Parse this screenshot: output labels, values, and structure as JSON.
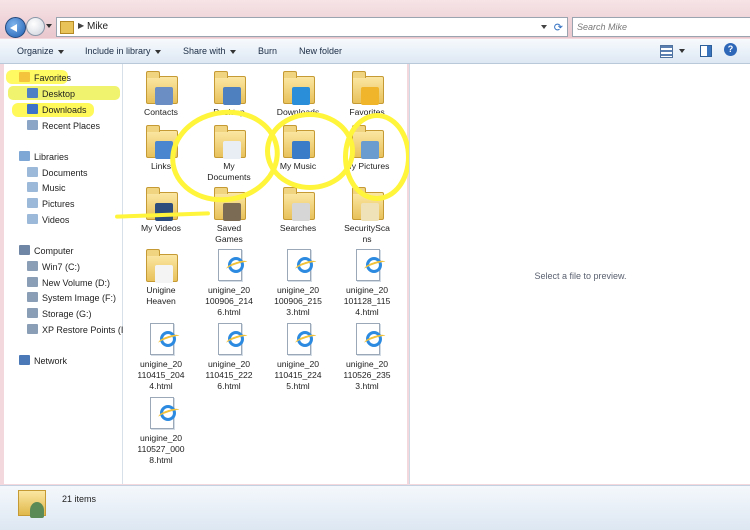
{
  "address": {
    "crumb": "Mike"
  },
  "search": {
    "placeholder": "Search Mike"
  },
  "toolbar": {
    "organize": "Organize",
    "include": "Include in library",
    "share": "Share with",
    "burn": "Burn",
    "new_folder": "New folder"
  },
  "nav": {
    "favorites": "Favorites",
    "favorites_items": [
      "Desktop",
      "Downloads",
      "Recent Places"
    ],
    "libraries": "Libraries",
    "libraries_items": [
      "Documents",
      "Music",
      "Pictures",
      "Videos"
    ],
    "computer": "Computer",
    "computer_items": [
      "Win7 (C:)",
      "New Volume (D:)",
      "System Image (F:)",
      "Storage (G:)",
      "XP Restore Points (I:"
    ],
    "network": "Network"
  },
  "files": [
    {
      "l1": "Contacts",
      "l2": ""
    },
    {
      "l1": "Desktop",
      "l2": ""
    },
    {
      "l1": "Downloads",
      "l2": ""
    },
    {
      "l1": "Favorites",
      "l2": ""
    },
    {
      "l1": "Links",
      "l2": ""
    },
    {
      "l1": "My",
      "l2": "Documents"
    },
    {
      "l1": "My Music",
      "l2": ""
    },
    {
      "l1": "My Pictures",
      "l2": ""
    },
    {
      "l1": "My Videos",
      "l2": ""
    },
    {
      "l1": "Saved",
      "l2": "Games"
    },
    {
      "l1": "Searches",
      "l2": ""
    },
    {
      "l1": "SecuritySca",
      "l2": "ns"
    },
    {
      "l1": "Unigine",
      "l2": "Heaven"
    },
    {
      "l1": "unigine_20",
      "l2": "100906_214",
      "l3": "6.html"
    },
    {
      "l1": "unigine_20",
      "l2": "100906_215",
      "l3": "3.html"
    },
    {
      "l1": "unigine_20",
      "l2": "101128_115",
      "l3": "4.html"
    },
    {
      "l1": "unigine_20",
      "l2": "110415_204",
      "l3": "4.html"
    },
    {
      "l1": "unigine_20",
      "l2": "110415_222",
      "l3": "6.html"
    },
    {
      "l1": "unigine_20",
      "l2": "110415_224",
      "l3": "5.html"
    },
    {
      "l1": "unigine_20",
      "l2": "110526_235",
      "l3": "3.html"
    },
    {
      "l1": "unigine_20",
      "l2": "110527_000",
      "l3": "8.html"
    }
  ],
  "preview": {
    "text": "Select a file to preview."
  },
  "details": {
    "count": "21 items"
  },
  "colors": {
    "highlight": "#fff53a",
    "accent": "#2e67b8"
  }
}
